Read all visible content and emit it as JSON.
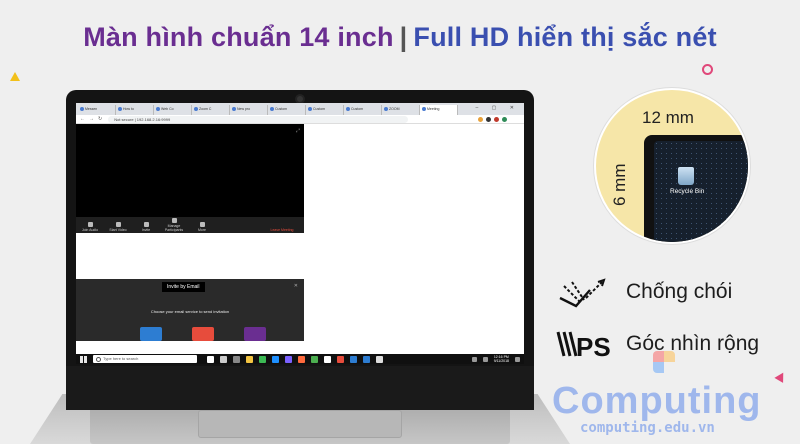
{
  "heading": {
    "part1": "Màn hình chuẩn 14 inch",
    "separator": "|",
    "part2": "Full HD",
    "part3": "hiển thị sắc nét"
  },
  "browser": {
    "tabs": [
      "Messen",
      "How to",
      "Web Co",
      "Zoom C",
      "New pro",
      "Custom",
      "Custom",
      "Custom",
      "ZOOM",
      "Meeting"
    ],
    "active_tab_index": 9,
    "address": "Not secure | 192.168.2.16:9999",
    "window_controls": "– ▢ ✕"
  },
  "video_controls": {
    "items": [
      "Join Audio",
      "Start Video",
      "Invite",
      "Manage Participants",
      "More"
    ],
    "end_label": "Leave Meeting"
  },
  "invite_dialog": {
    "title": "Invite by Email",
    "message": "Choose your email service to send invitation"
  },
  "taskbar": {
    "search_placeholder": "Type here to search",
    "time": "12:16 PM",
    "date": "9/11/2018",
    "app_colors": [
      "#ffffff",
      "#cccccc",
      "#888888",
      "#f4c542",
      "#3cba54",
      "#1e90ff",
      "#7b61ff",
      "#ff6a3d",
      "#4caf50",
      "#ffffff",
      "#e74c3c",
      "#2d7dd2",
      "#2d7dd2",
      "#dddddd"
    ]
  },
  "zoom": {
    "width_label": "12 mm",
    "height_label": "6 mm",
    "desktop_icon_label": "Recycle Bin"
  },
  "features": [
    {
      "icon": "anti-glare-icon",
      "label": "Chống chói"
    },
    {
      "icon": "ips-icon",
      "label": "Góc nhìn rộng"
    }
  ],
  "logo": {
    "word": "Computing",
    "url": "computing.edu.vn"
  },
  "colors": {
    "heading_purple": "#6a2e91",
    "heading_blue": "#3a4fb0",
    "logo_blue": "#9fb7ec",
    "zoom_bg": "#f6e6a8"
  }
}
